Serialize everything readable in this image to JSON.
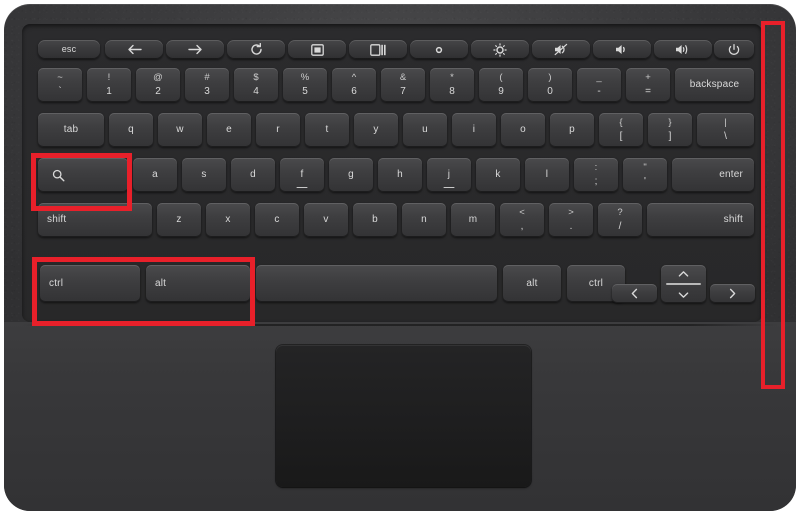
{
  "device": {
    "type": "chromebook-laptop-keyboard",
    "surface_color": "#343436",
    "key_color": "#3e3e40",
    "key_text_color": "#d9d9d9",
    "trackpad_color": "#1e1e1f"
  },
  "annotations": {
    "color": "#e8202a",
    "boxes": [
      {
        "name": "search-key-highlight",
        "target": "search-key"
      },
      {
        "name": "ctrl-alt-keys-highlight",
        "target": "ctrl-key, alt-key"
      },
      {
        "name": "right-hinge-edge-highlight",
        "target": "right-side-edge"
      }
    ]
  },
  "keyboard": {
    "function_row": [
      {
        "label": "esc",
        "icon": "",
        "name": "esc"
      },
      {
        "label": "",
        "icon": "back-arrow-icon",
        "name": "back"
      },
      {
        "label": "",
        "icon": "forward-arrow-icon",
        "name": "forward"
      },
      {
        "label": "",
        "icon": "reload-icon",
        "name": "reload"
      },
      {
        "label": "",
        "icon": "fullscreen-icon",
        "name": "fullscreen"
      },
      {
        "label": "",
        "icon": "overview-windows-icon",
        "name": "overview"
      },
      {
        "label": "",
        "icon": "brightness-down-icon",
        "name": "brightness-down"
      },
      {
        "label": "",
        "icon": "brightness-up-icon",
        "name": "brightness-up"
      },
      {
        "label": "",
        "icon": "mute-icon",
        "name": "mute"
      },
      {
        "label": "",
        "icon": "volume-down-icon",
        "name": "volume-down"
      },
      {
        "label": "",
        "icon": "volume-up-icon",
        "name": "volume-up"
      },
      {
        "label": "",
        "icon": "power-icon",
        "name": "power"
      }
    ],
    "number_row": [
      {
        "top": "~",
        "bottom": "`",
        "name": "backtick"
      },
      {
        "top": "!",
        "bottom": "1",
        "name": "1"
      },
      {
        "top": "@",
        "bottom": "2",
        "name": "2"
      },
      {
        "top": "#",
        "bottom": "3",
        "name": "3"
      },
      {
        "top": "$",
        "bottom": "4",
        "name": "4"
      },
      {
        "top": "%",
        "bottom": "5",
        "name": "5"
      },
      {
        "top": "^",
        "bottom": "6",
        "name": "6"
      },
      {
        "top": "&",
        "bottom": "7",
        "name": "7"
      },
      {
        "top": "*",
        "bottom": "8",
        "name": "8"
      },
      {
        "top": "(",
        "bottom": "9",
        "name": "9"
      },
      {
        "top": ")",
        "bottom": "0",
        "name": "0"
      },
      {
        "top": "_",
        "bottom": "-",
        "name": "minus"
      },
      {
        "top": "+",
        "bottom": "=",
        "name": "equals"
      }
    ],
    "backspace_label": "backspace",
    "tab_label": "tab",
    "top_row": [
      {
        "label": "q",
        "name": "q"
      },
      {
        "label": "w",
        "name": "w"
      },
      {
        "label": "e",
        "name": "e"
      },
      {
        "label": "r",
        "name": "r"
      },
      {
        "label": "t",
        "name": "t"
      },
      {
        "label": "y",
        "name": "y"
      },
      {
        "label": "u",
        "name": "u"
      },
      {
        "label": "i",
        "name": "i"
      },
      {
        "label": "o",
        "name": "o"
      },
      {
        "label": "p",
        "name": "p"
      }
    ],
    "top_row_brackets": [
      {
        "top": "{",
        "bottom": "[",
        "name": "left-bracket"
      },
      {
        "top": "}",
        "bottom": "]",
        "name": "right-bracket"
      },
      {
        "top": "|",
        "bottom": "\\",
        "name": "backslash"
      }
    ],
    "search_key": {
      "icon": "search-icon",
      "label": "",
      "name": "search"
    },
    "home_row": [
      {
        "label": "a",
        "name": "a"
      },
      {
        "label": "s",
        "name": "s"
      },
      {
        "label": "d",
        "name": "d"
      },
      {
        "label": "f",
        "name": "f",
        "homing": true
      },
      {
        "label": "g",
        "name": "g"
      },
      {
        "label": "h",
        "name": "h"
      },
      {
        "label": "j",
        "name": "j",
        "homing": true
      },
      {
        "label": "k",
        "name": "k"
      },
      {
        "label": "l",
        "name": "l"
      }
    ],
    "home_row_punct": [
      {
        "top": ":",
        "bottom": ";",
        "name": "semicolon"
      },
      {
        "top": "\"",
        "bottom": "'",
        "name": "quote"
      }
    ],
    "enter_label": "enter",
    "shift_left_label": "shift",
    "shift_right_label": "shift",
    "bottom_letters": [
      {
        "label": "z",
        "name": "z"
      },
      {
        "label": "x",
        "name": "x"
      },
      {
        "label": "c",
        "name": "c"
      },
      {
        "label": "v",
        "name": "v"
      },
      {
        "label": "b",
        "name": "b"
      },
      {
        "label": "n",
        "name": "n"
      },
      {
        "label": "m",
        "name": "m"
      }
    ],
    "bottom_punct": [
      {
        "top": "<",
        "bottom": ",",
        "name": "comma"
      },
      {
        "top": ">",
        "bottom": ".",
        "name": "period"
      },
      {
        "top": "?",
        "bottom": "/",
        "name": "slash"
      }
    ],
    "modifier_row": {
      "ctrl_left": "ctrl",
      "alt_left": "alt",
      "space": "",
      "alt_right": "alt",
      "ctrl_right": "ctrl"
    },
    "arrows": [
      {
        "icon": "arrow-left-icon",
        "name": "arrow-left"
      },
      {
        "icon": "arrow-up-icon",
        "name": "arrow-up"
      },
      {
        "icon": "arrow-down-icon",
        "name": "arrow-down"
      },
      {
        "icon": "arrow-right-icon",
        "name": "arrow-right"
      }
    ]
  }
}
